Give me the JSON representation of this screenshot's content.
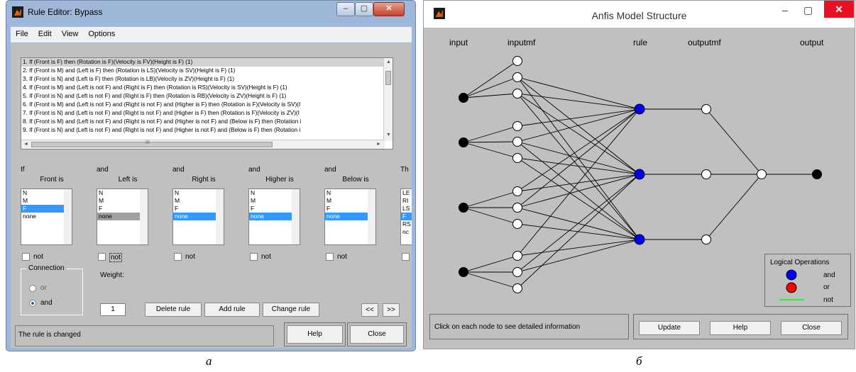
{
  "rule_editor": {
    "title": "Rule Editor: Bypass",
    "window_controls": {
      "minimize": "–",
      "maximize": "▢",
      "close": "✕"
    },
    "menu": [
      "File",
      "Edit",
      "View",
      "Options"
    ],
    "rules": [
      "1. If (Front is F) then (Rotation is F)(Velocity is FV)(Height is F) (1)",
      "2. If (Front is M) and (Left is F) then (Rotation is LS)(Velocity is SV)(Height is F) (1)",
      "3. If (Front is N) and (Left is F) then (Rotation is LB)(Velocity is ZV)(Height is F) (1)",
      "4. If (Front is M) and (Left is not F) and (Right is F) then (Rotation is RS)(Velocity is SV)(Height is F) (1)",
      "5. If (Front is N) and (Left is not F) and (Right is F) then (Rotation is RB)(Velocity is ZV)(Height is F) (1)",
      "6. If (Front is M) and (Left is not F) and (Right is not F) and (Higher is F) then (Rotation is F)(Velocity is SV)(I",
      "7. If (Front is N) and (Left is not F) and (Right is not F) and (Higher is F) then (Rotation is F)(Velocity is ZV)(I",
      "8. If (Front is M) and (Left is not F) and (Right is not F) and (Higher is not F) and (Below is F) then (Rotation i",
      "9. If (Front is N) and (Left is not F) and (Right is not F) and (Higher is not F) and (Below is F) then (Rotation i"
    ],
    "scroll_glyphs": {
      "up": "▲",
      "down": "▼",
      "left": "◄",
      "right": "►",
      "grip": "III"
    },
    "antecedents": [
      {
        "conj": "If",
        "label": "Front is",
        "items": [
          "N",
          "M",
          "F",
          "none"
        ],
        "not": "not"
      },
      {
        "conj": "and",
        "label": "Left is",
        "items": [
          "N",
          "M",
          "F",
          "none"
        ],
        "not": "not"
      },
      {
        "conj": "and",
        "label": "Right is",
        "items": [
          "N",
          "M",
          "F",
          "none"
        ],
        "not": "not"
      },
      {
        "conj": "and",
        "label": "Higher is",
        "items": [
          "N",
          "M",
          "F",
          "none"
        ],
        "not": "not"
      },
      {
        "conj": "and",
        "label": "Below is",
        "items": [
          "N",
          "M",
          "F",
          "none"
        ],
        "not": "not"
      }
    ],
    "then_cut": {
      "conj": "Th",
      "items": [
        "LE",
        "RI",
        "LS",
        "F",
        "RS",
        "nc"
      ]
    },
    "connection": {
      "label": "Connection",
      "or": "or",
      "and": "and"
    },
    "weight_label": "Weight:",
    "weight_value": "1",
    "buttons": {
      "delete": "Delete rule",
      "add": "Add rule",
      "change": "Change rule",
      "prev": "<<",
      "next": ">>",
      "help": "Help",
      "close": "Close"
    },
    "status": "The rule is changed"
  },
  "anfis": {
    "title": "Anfis Model Structure",
    "window_controls": {
      "minimize": "–",
      "maximize": "▢",
      "close": "✕"
    },
    "columns": [
      "input",
      "inputmf",
      "rule",
      "outputmf",
      "output"
    ],
    "legend": {
      "title": "Logical Operations",
      "and": "and",
      "or": "or",
      "not": "not"
    },
    "colors": {
      "and": "#0000ff",
      "or": "#ff0000",
      "not": "#00ff00",
      "input_node": "#000000",
      "mf_node": "#ffffff"
    },
    "status": "Click on each node to see detailed information",
    "buttons": {
      "update": "Update",
      "help": "Help",
      "close": "Close"
    }
  },
  "captions": {
    "a": "а",
    "b": "б"
  }
}
